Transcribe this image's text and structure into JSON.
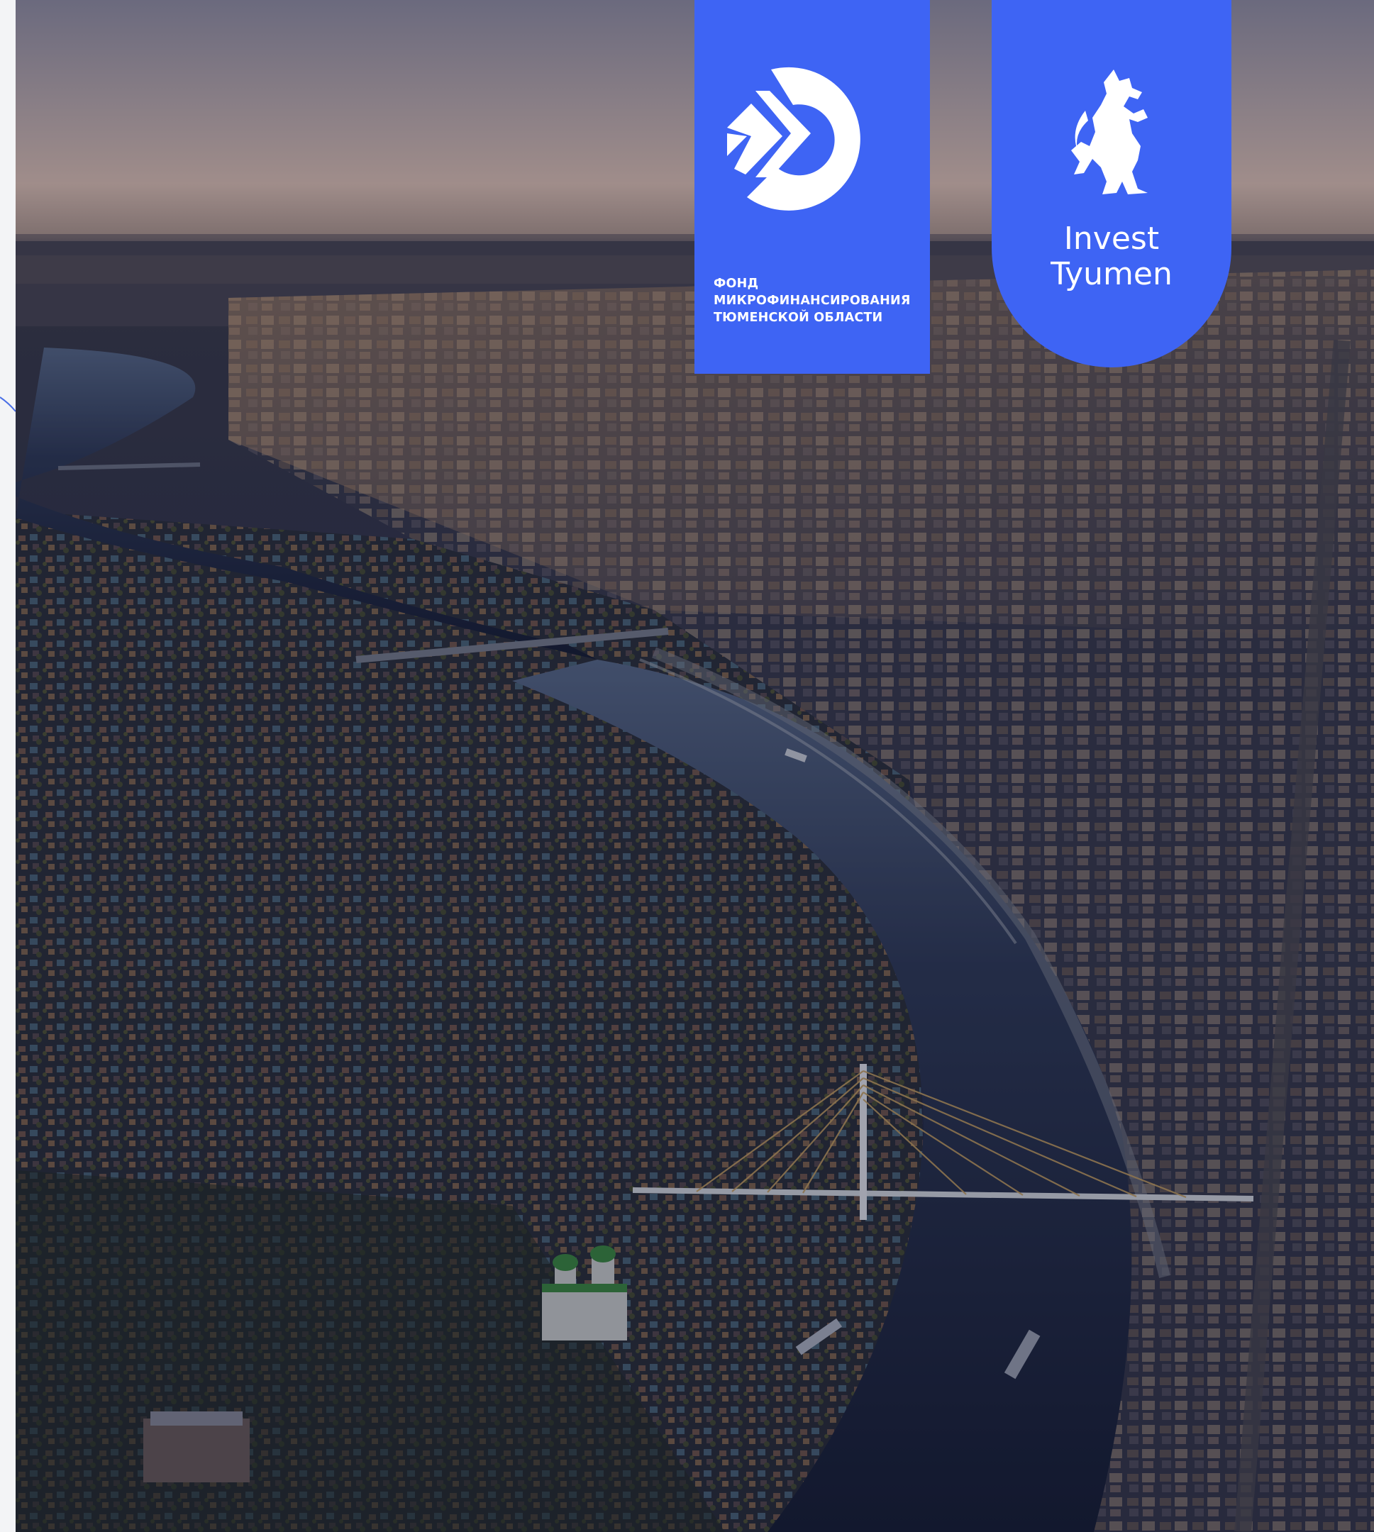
{
  "image": {
    "subject": "aerial-city-river-dusk",
    "palette": {
      "sky_top": "#6b6a7e",
      "sky_horizon": "#a08d8a",
      "city_shadow": "#2a2d42",
      "river": "#1c2235",
      "brand_blue": "#3e64f4",
      "logo_white": "#ffffff"
    }
  },
  "logos": {
    "fund": {
      "line1": "ФОНД",
      "line2": "МИКРОФИНАНСИРОВАНИЯ",
      "line3": "ТЮМЕНСКОЙ ОБЛАСТИ",
      "emblem": "fund-mark-icon"
    },
    "invest": {
      "line1": "Invest",
      "line2": "Tyumen",
      "emblem": "fox-emblem-icon"
    }
  }
}
